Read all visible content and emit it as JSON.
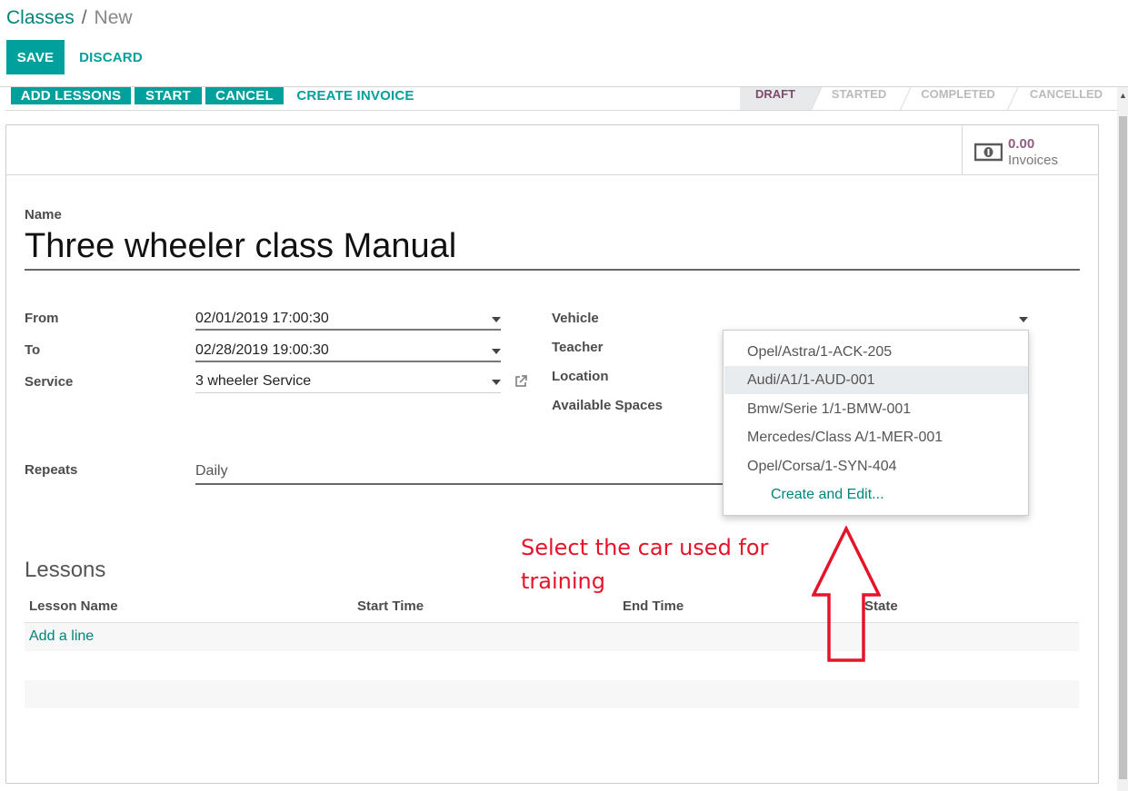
{
  "breadcrumb": {
    "parent": "Classes",
    "separator": "/",
    "current": "New"
  },
  "toolbar": {
    "save": "SAVE",
    "discard": "DISCARD"
  },
  "actions": {
    "add_lessons": "ADD LESSONS",
    "start": "START",
    "cancel": "CANCEL",
    "create_invoice": "CREATE INVOICE"
  },
  "stages": {
    "draft": "DRAFT",
    "started": "STARTED",
    "completed": "COMPLETED",
    "cancelled": "CANCELLED",
    "active": "draft"
  },
  "smart_button": {
    "value": "0.00",
    "label": "Invoices",
    "icon": "money-icon"
  },
  "form": {
    "name_label": "Name",
    "name_value": "Three wheeler class Manual",
    "from_label": "From",
    "from_value": "02/01/2019 17:00:30",
    "to_label": "To",
    "to_value": "02/28/2019 19:00:30",
    "service_label": "Service",
    "service_value": "3 wheeler Service",
    "vehicle_label": "Vehicle",
    "teacher_label": "Teacher",
    "location_label": "Location",
    "available_label": "Available Spaces",
    "repeats_label": "Repeats",
    "repeats_value": "Daily"
  },
  "vehicle_dropdown": {
    "options": [
      "Opel/Astra/1-ACK-205",
      "Audi/A1/1-AUD-001",
      "Bmw/Serie 1/1-BMW-001",
      "Mercedes/Class A/1-MER-001",
      "Opel/Corsa/1-SYN-404"
    ],
    "highlighted": "Audi/A1/1-AUD-001",
    "create": "Create and Edit..."
  },
  "lessons": {
    "title": "Lessons",
    "columns": [
      "Lesson Name",
      "Start Time",
      "End Time",
      "State"
    ],
    "add_line": "Add a line"
  },
  "annotation": {
    "text": "Select the car used for training",
    "color": "#e5142a"
  },
  "colors": {
    "primary": "#00a09d",
    "link": "#00837a",
    "stage_active": "#7c4c6c"
  }
}
